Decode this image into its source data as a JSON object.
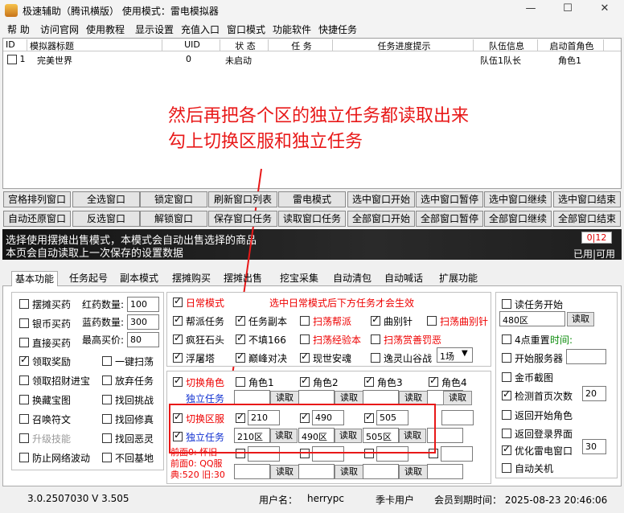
{
  "window": {
    "title": "极速辅助（腾讯横版）  使用模式：雷电模拟器",
    "minimize": "—",
    "maximize": "☐",
    "close": "✕"
  },
  "menu": [
    "帮 助",
    "访问官网",
    "使用教程",
    "显示设置",
    "充值入口",
    "窗口模式",
    "功能软件",
    "快捷任务"
  ],
  "table": {
    "headers": [
      "ID",
      "模拟器标题",
      "UID",
      "状 态",
      "任 务",
      "任务进度提示",
      "队伍信息",
      "启动首角色"
    ],
    "rows": [
      {
        "id": "1",
        "title": "完美世界",
        "uid": "0",
        "status": "未启动",
        "task": "",
        "progress": "",
        "team": "队伍1队长",
        "role": "角色1"
      }
    ]
  },
  "annotation": {
    "line1": "然后再把各个区的独立任务都读取出来",
    "line2": "勾上切换区服和独立任务"
  },
  "buttons_row1": [
    "宫格排列窗口",
    "全选窗口",
    "锁定窗口",
    "刷新窗口列表",
    "雷电模式",
    "选中窗口开始",
    "选中窗口暂停",
    "选中窗口继续",
    "选中窗口结束"
  ],
  "buttons_row2": [
    "自动还原窗口",
    "反选窗口",
    "解锁窗口",
    "保存窗口任务",
    "读取窗口任务",
    "全部窗口开始",
    "全部窗口暂停",
    "全部窗口继续",
    "全部窗口结束"
  ],
  "banner": {
    "line1": "选择使用摆摊出售模式，本模式会自动出售选择的商品",
    "line2": "本页会自动读取上一次保存的设置数据",
    "counter": "0|12",
    "counter_label": "已用|可用"
  },
  "tabs": [
    "基本功能",
    "任务起号",
    "副本模式",
    "摆摊购买",
    "摆摊出售",
    "挖宝采集",
    "自动清包",
    "自动喊话",
    "扩展功能"
  ],
  "left": {
    "c1": [
      "摆摊买药",
      "银币买药",
      "直接买药",
      "领取奖励",
      "领取招财进宝",
      "换藏宝图",
      "召唤符文",
      "升级技能",
      "防止网络波动"
    ],
    "c1_checked": [
      false,
      false,
      false,
      true,
      false,
      false,
      false,
      false,
      false
    ],
    "red_qty_label": "红药数量:",
    "red_qty": "100",
    "blue_qty_label": "蓝药数量:",
    "blue_qty": "300",
    "max_price_label": "最高买价:",
    "max_price": "80",
    "c2": [
      "一键扫荡",
      "放弃任务",
      "找回挑战",
      "找回修真",
      "找回恶灵",
      "不回基地"
    ]
  },
  "mid": {
    "daily_mode": "日常模式",
    "daily_hint": "选中日常模式后下方任务才会生效",
    "tasks": [
      {
        "label": "帮派任务",
        "on": true,
        "color": "black"
      },
      {
        "label": "任务副本",
        "on": true,
        "color": "black"
      },
      {
        "label": "扫荡帮派",
        "on": false,
        "color": "red"
      },
      {
        "label": "曲别针",
        "on": true,
        "color": "black"
      },
      {
        "label": "扫荡曲别针",
        "on": false,
        "color": "red"
      },
      {
        "label": "疯狂石头",
        "on": true,
        "color": "black"
      },
      {
        "label": "不填166",
        "on": true,
        "color": "black"
      },
      {
        "label": "扫荡经验本",
        "on": false,
        "color": "red"
      },
      {
        "label": "扫荡赏善罚恶",
        "on": false,
        "color": "red"
      },
      {
        "label": "浮屠塔",
        "on": true,
        "color": "black"
      },
      {
        "label": "巅峰对决",
        "on": true,
        "color": "black"
      },
      {
        "label": "现世安魂",
        "on": true,
        "color": "black"
      },
      {
        "label": "逸灵山谷战",
        "on": false,
        "color": "black"
      }
    ],
    "rounds": "1场",
    "switch_role": "切换角色",
    "roles": [
      "角色1",
      "角色2",
      "角色3",
      "角色4"
    ],
    "roles_checked": [
      false,
      true,
      true,
      true
    ],
    "indep_task": "独立任务",
    "read": "读取",
    "switch_server": "切换区服",
    "servers": [
      "210",
      "490",
      "505"
    ],
    "server_tasks": [
      "210区",
      "490区",
      "505区"
    ],
    "hint1": "前面0: 怀旧",
    "hint2": "前面0: QQ服",
    "hint3": "典:520 旧:30"
  },
  "right": {
    "read_start": "读任务开始",
    "read_val": "480区",
    "read_btn": "读取",
    "reset4": "4点重置",
    "time_label": "时间:",
    "start_server": "开始服务器",
    "gold_screenshot": "金币截图",
    "detect_label": "检测首页次数",
    "detect_val": "20",
    "back_role": "返回开始角色",
    "back_login": "返回登录界面",
    "optimize": "优化雷电窗口",
    "optimize_val": "30",
    "auto_shutdown": "自动关机"
  },
  "status": {
    "version": "3.0.2507030   V 3.505",
    "user_label": "用户名：",
    "user": "herrypc",
    "card": "季卡用户",
    "expire": "会员到期时间：  2025-08-23 20:46:06"
  }
}
